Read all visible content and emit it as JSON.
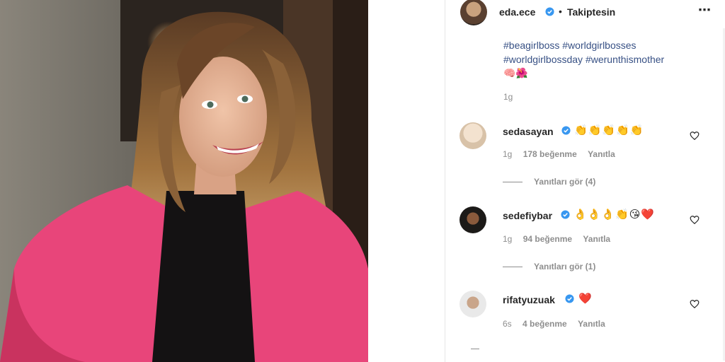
{
  "post": {
    "author": "eda.ece",
    "follow_status": "Takiptesin",
    "more_icon": "more-horizontal-icon",
    "hashtags": [
      "#beagirlboss #worldgirlbosses",
      "#worldgirlbossday #werunthismother"
    ],
    "caption_emojis": "🧠🌺",
    "time": "1g"
  },
  "comments": [
    {
      "user": "sedasayan",
      "text": "👏👏👏👏👏",
      "time": "1g",
      "likes": "178 beğenme",
      "reply": "Yanıtla",
      "view_replies": "Yanıtları gör (4)"
    },
    {
      "user": "sedefiybar",
      "text": "👌👌👌👏😘❤️",
      "time": "1g",
      "likes": "94 beğenme",
      "reply": "Yanıtla",
      "view_replies": "Yanıtları gör (1)"
    },
    {
      "user": "rifatyuzuak",
      "text": "❤️",
      "time": "6s",
      "likes": "4 beğenme",
      "reply": "Yanıtla"
    }
  ],
  "colors": {
    "link": "#385185",
    "verified": "#3897f0",
    "muted": "#8e8e8e",
    "jacket": "#e8457a"
  }
}
